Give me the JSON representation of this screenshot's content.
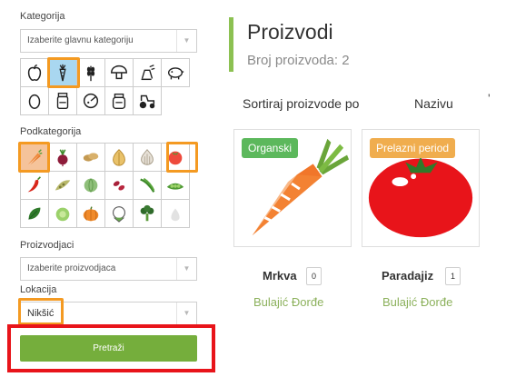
{
  "sidebar": {
    "category_label": "Kategorija",
    "category_placeholder": "Izaberite glavnu kategoriju",
    "category_icons": [
      "apple-icon",
      "carrot-icon",
      "wheat-icon",
      "mushroom-icon",
      "bread-icon",
      "pig-icon",
      "egg-icon",
      "jar-icon",
      "cheese-icon",
      "pot-icon",
      "tractor-icon"
    ],
    "subcategory_label": "Podkategorija",
    "subcategory_icons": [
      "carrots-icon",
      "beetroot-icon",
      "potatoes-icon",
      "onion-icon",
      "garlic-icon",
      "tomato-icon",
      "chili-icon",
      "pea-pod-icon",
      "cabbage-icon",
      "beans-icon",
      "green-beans-icon",
      "peas-icon",
      "spinach-icon",
      "lettuce-icon",
      "pumpkin-icon",
      "cauliflower-icon",
      "broccoli-icon",
      "other-vegetable-icon"
    ],
    "producer_label": "Proizvodjaci",
    "producer_placeholder": "Izaberite proizvodjaca",
    "location_label": "Lokacija",
    "location_value": "Nikšić",
    "search_button": "Pretraži"
  },
  "main": {
    "title": "Proizvodi",
    "count_text": "Broj proizvoda: 2",
    "sort_label": "Sortiraj proizvode po",
    "sort_value": "Nazivu",
    "sort_more": "'",
    "products": [
      {
        "badge": "Organski",
        "badge_color": "#5cb85c",
        "name": "Mrkva",
        "qty": "0",
        "seller": "Bulajić Đorđe",
        "image": "carrot-image"
      },
      {
        "badge": "Prelazni period",
        "badge_color": "#f0ad4e",
        "name": "Paradajiz",
        "qty": "1",
        "seller": "Bulajić Đorđe",
        "image": "tomato-image"
      }
    ]
  },
  "colors": {
    "accent_green": "#75ae3c",
    "highlight_orange": "#f49a22",
    "highlight_red": "#e8141a",
    "selected_blue": "#a9d7f0"
  }
}
